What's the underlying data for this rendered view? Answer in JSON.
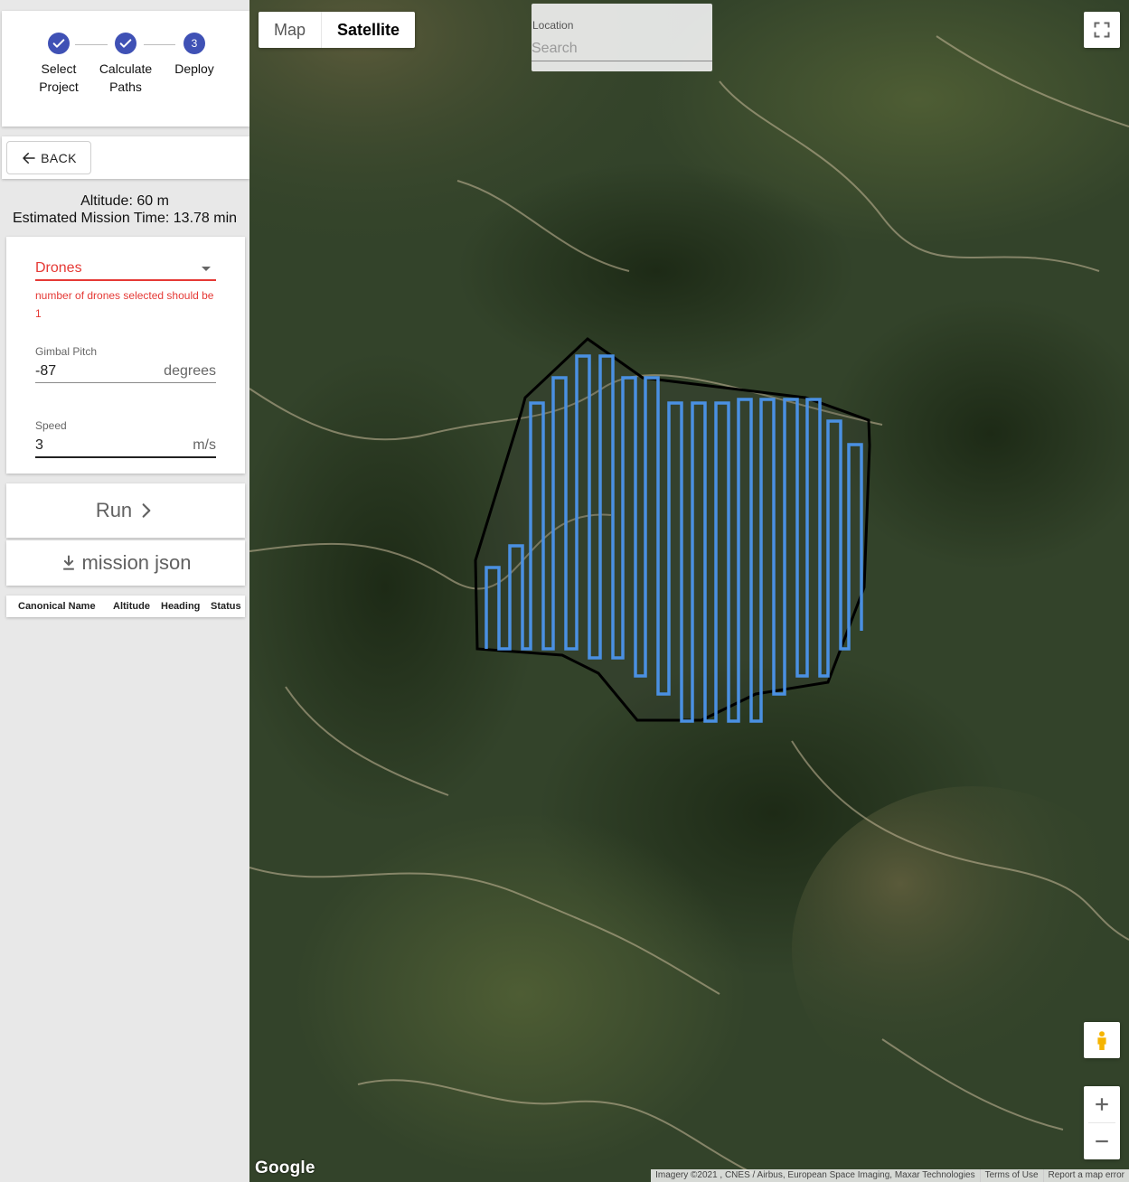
{
  "stepper": {
    "steps": [
      {
        "label": "Select\nProject",
        "state": "complete"
      },
      {
        "label": "Calculate\nPaths",
        "state": "complete"
      },
      {
        "label": "Deploy",
        "number": "3",
        "state": "active"
      }
    ]
  },
  "nav": {
    "back_label": "BACK"
  },
  "mission": {
    "altitude_text": "Altitude: 60 m",
    "time_text": "Estimated Mission Time: 13.78 min"
  },
  "form": {
    "drones": {
      "label": "Drones",
      "error": "number of drones selected should be 1"
    },
    "gimbal": {
      "label": "Gimbal Pitch",
      "value": "-87",
      "unit": "degrees"
    },
    "speed": {
      "label": "Speed",
      "value": "3",
      "unit": "m/s"
    }
  },
  "actions": {
    "run_label": "Run",
    "json_label": "mission json"
  },
  "drone_table": {
    "columns": [
      "Canonical Name",
      "Altitude",
      "Heading",
      "Status"
    ]
  },
  "map": {
    "type_options": [
      "Map",
      "Satellite"
    ],
    "selected_type": "Satellite",
    "location": {
      "label": "Location",
      "placeholder": "Search"
    },
    "logo": "Google",
    "attribution": [
      "Imagery ©2021 , CNES / Airbus, European Space Imaging, Maxar Technologies",
      "Terms of Use",
      "Report a map error"
    ]
  },
  "colors": {
    "accent": "#3f51b5",
    "error": "#e53935",
    "flight_path": "#4a90e2",
    "boundary": "#000000"
  },
  "icons": [
    "check-icon",
    "arrow-left-icon",
    "chevron-right-icon",
    "download-icon",
    "fullscreen-icon",
    "pegman-icon",
    "plus-icon",
    "minus-icon"
  ]
}
